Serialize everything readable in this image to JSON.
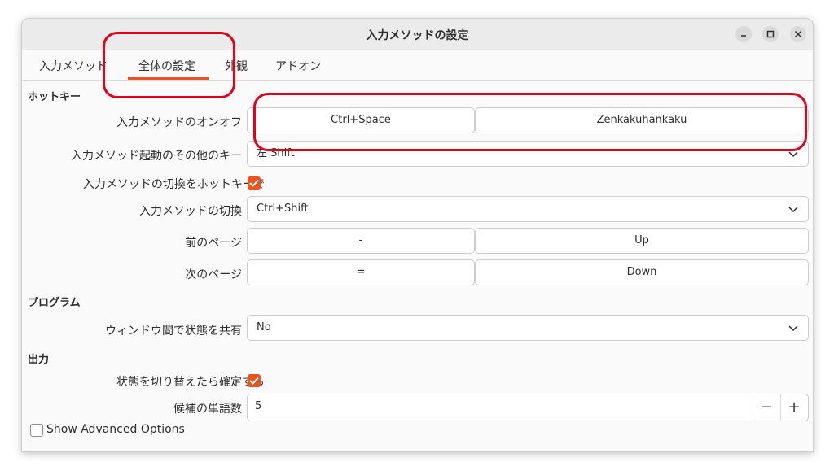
{
  "window": {
    "title": "入力メソッドの設定"
  },
  "tabs": [
    {
      "label": "入力メソッド"
    },
    {
      "label": "全体の設定"
    },
    {
      "label": "外観"
    },
    {
      "label": "アドオン"
    }
  ],
  "sections": {
    "hotkey": "ホットキー",
    "program": "プログラム",
    "output": "出力"
  },
  "rows": {
    "toggle": {
      "label": "入力メソッドのオンオフ",
      "key1": "Ctrl+Space",
      "key2": "Zenkakuhankaku"
    },
    "activate_other": {
      "label": "入力メソッド起動のその他のキー",
      "value": "左 Shift"
    },
    "switch_with_hotkey": {
      "label": "入力メソッドの切換をホットキーで",
      "checked": true
    },
    "switch": {
      "label": "入力メソッドの切換",
      "value": "Ctrl+Shift"
    },
    "prev_page": {
      "label": "前のページ",
      "key1": "-",
      "key2": "Up"
    },
    "next_page": {
      "label": "次のページ",
      "key1": "=",
      "key2": "Down"
    },
    "share_state": {
      "label": "ウィンドウ間で状態を共有",
      "value": "No"
    },
    "commit_on_switch": {
      "label": "状態を切り替えたら確定する",
      "checked": true
    },
    "candidate_count": {
      "label": "候補の単語数",
      "value": "5",
      "minus": "−",
      "plus": "+"
    }
  },
  "advanced": {
    "label": "Show Advanced Options",
    "checked": false
  },
  "colors": {
    "accent": "#e95420",
    "annotation": "#e3001b"
  }
}
